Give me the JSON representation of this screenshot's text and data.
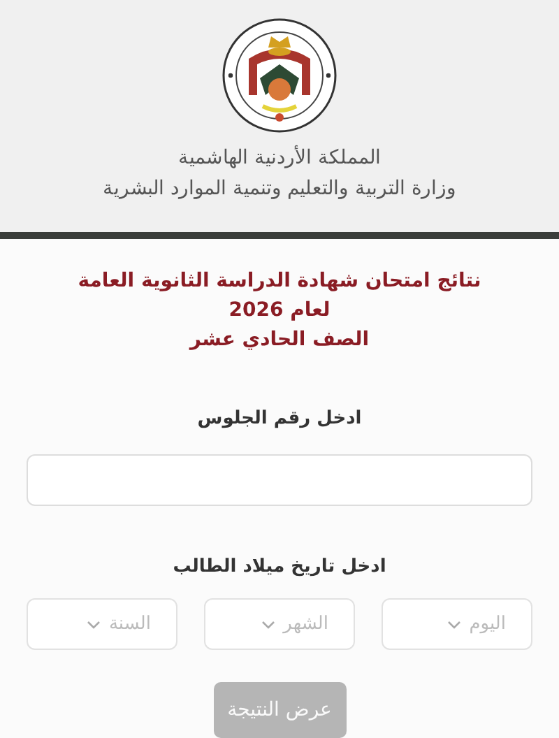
{
  "header": {
    "kingdom": "المملكة الأردنية الهاشمية",
    "ministry": "وزارة التربية والتعليم وتنمية الموارد البشرية"
  },
  "titles": [
    "نتائج امتحان شهادة الدراسة الثانوية العامة",
    "لعام 2026",
    "الصف الحادي عشر"
  ],
  "seat_field": {
    "label": "ادخل رقم الجلوس"
  },
  "birth_date": {
    "label": "ادخل تاريخ ميلاد الطالب",
    "selects": [
      {
        "placeholder": "اليوم"
      },
      {
        "placeholder": "الشهر"
      },
      {
        "placeholder": "السنة"
      }
    ]
  },
  "submit": {
    "label": "عرض النتيجة",
    "disabled": true
  }
}
